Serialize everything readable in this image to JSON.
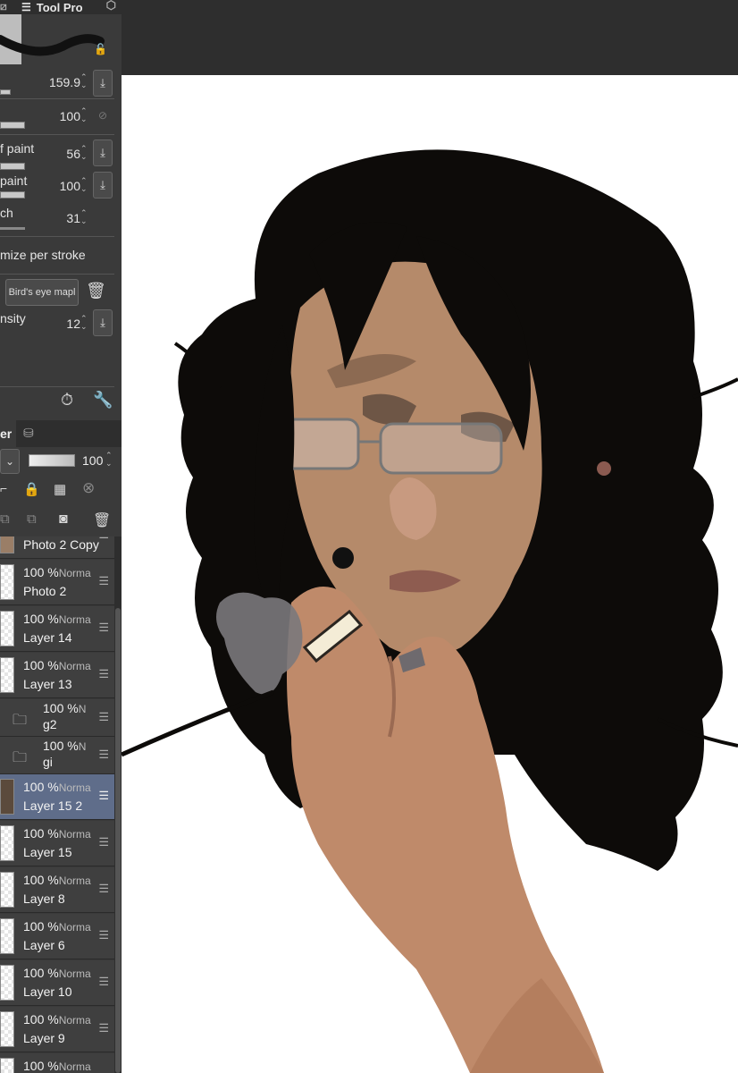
{
  "tool_property": {
    "tab_label": "Tool Pro",
    "rows": [
      {
        "label": "",
        "value": "159.9"
      },
      {
        "label": "",
        "value": "100"
      },
      {
        "label": "f paint",
        "value": "56"
      },
      {
        "label": "paint",
        "value": "100"
      },
      {
        "label": "ch",
        "value": "31"
      }
    ],
    "stroke_option": "mize per stroke",
    "texture_button": "Bird's eye mapl",
    "density_label": "nsity",
    "density_value": "12"
  },
  "layer_panel": {
    "tab_label": "er",
    "opacity_value": "100",
    "layers": [
      {
        "pct": "",
        "mode": "",
        "name": "Photo 2 Copy",
        "selected": false,
        "folder": false
      },
      {
        "pct": "100 %",
        "mode": "Norma",
        "name": "Photo 2",
        "selected": false,
        "folder": false
      },
      {
        "pct": "100 %",
        "mode": "Norma",
        "name": "Layer 14",
        "selected": false,
        "folder": false
      },
      {
        "pct": "100 %",
        "mode": "Norma",
        "name": "Layer 13",
        "selected": false,
        "folder": false
      },
      {
        "pct": "100 %",
        "mode": "N",
        "name": "g2",
        "selected": false,
        "folder": true
      },
      {
        "pct": "100 %",
        "mode": "N",
        "name": "gi",
        "selected": false,
        "folder": true
      },
      {
        "pct": "100 %",
        "mode": "Norma",
        "name": "Layer 15 2",
        "selected": true,
        "folder": false
      },
      {
        "pct": "100 %",
        "mode": "Norma",
        "name": "Layer 15",
        "selected": false,
        "folder": false
      },
      {
        "pct": "100 %",
        "mode": "Norma",
        "name": "Layer 8",
        "selected": false,
        "folder": false
      },
      {
        "pct": "100 %",
        "mode": "Norma",
        "name": "Layer 6",
        "selected": false,
        "folder": false
      },
      {
        "pct": "100 %",
        "mode": "Norma",
        "name": "Layer 10",
        "selected": false,
        "folder": false
      },
      {
        "pct": "100 %",
        "mode": "Norma",
        "name": "Layer 9",
        "selected": false,
        "folder": false
      },
      {
        "pct": "100 %",
        "mode": "Norma",
        "name": "",
        "selected": false,
        "folder": false
      }
    ]
  },
  "icons": {
    "spin": "spinner-arrows-icon",
    "download": "download-arrow-icon",
    "trash": "trash-icon",
    "timer": "stopwatch-icon",
    "wrench": "wrench-icon",
    "lock": "lock-icon"
  },
  "colors": {
    "panel": "#3a3a3a",
    "selected_layer": "#5f6d8a",
    "topbar": "#2e2e2e",
    "canvas": "#ffffff"
  }
}
